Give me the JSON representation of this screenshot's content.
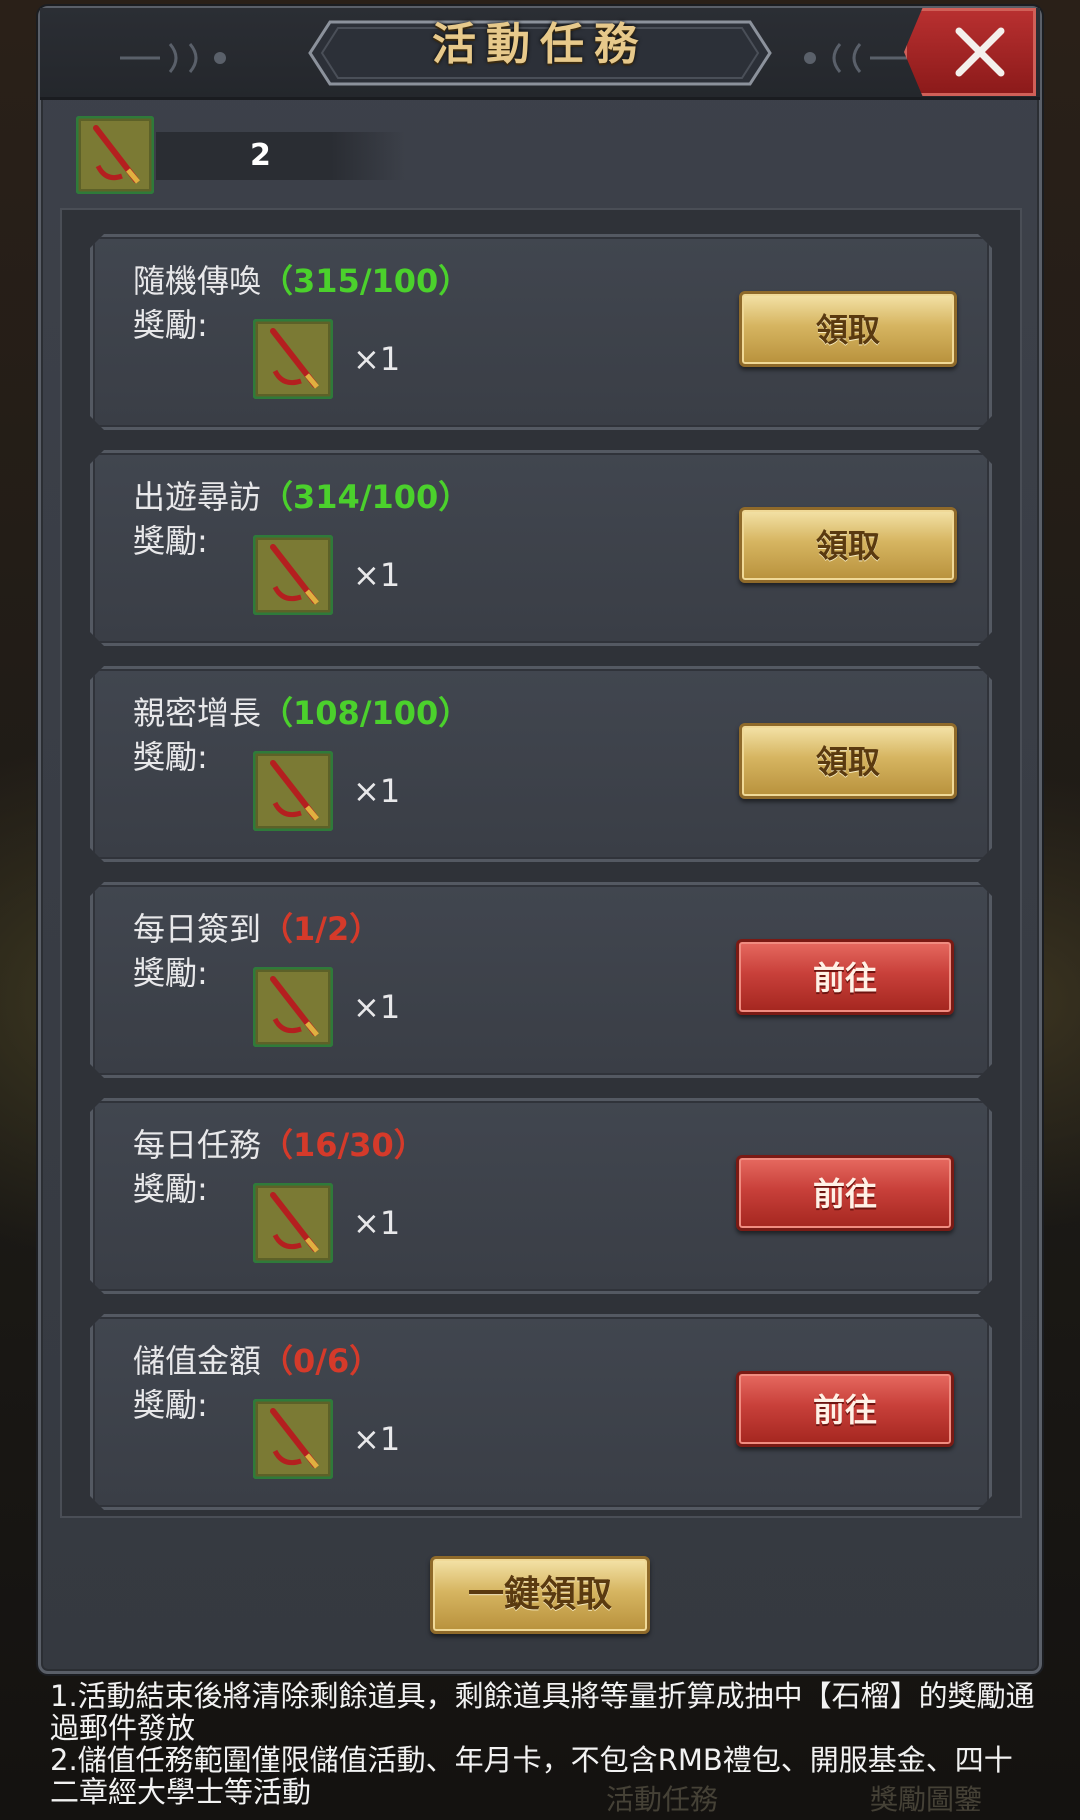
{
  "title": "活動任務",
  "currency": {
    "value": "2",
    "icon": "brush-pen-item-icon"
  },
  "tasks": [
    {
      "name": "隨機傳喚",
      "progress": "（315/100）",
      "done": true,
      "reward_label": "獎勵:",
      "reward_qty": "×1",
      "button": "領取"
    },
    {
      "name": "出遊尋訪",
      "progress": "（314/100）",
      "done": true,
      "reward_label": "獎勵:",
      "reward_qty": "×1",
      "button": "領取"
    },
    {
      "name": "親密增長",
      "progress": "（108/100）",
      "done": true,
      "reward_label": "獎勵:",
      "reward_qty": "×1",
      "button": "領取"
    },
    {
      "name": "每日簽到",
      "progress": "（1/2）",
      "done": false,
      "reward_label": "獎勵:",
      "reward_qty": "×1",
      "button": "前往"
    },
    {
      "name": "每日任務",
      "progress": "（16/30）",
      "done": false,
      "reward_label": "獎勵:",
      "reward_qty": "×1",
      "button": "前往"
    },
    {
      "name": "儲值金額",
      "progress": "（0/6）",
      "done": false,
      "reward_label": "獎勵:",
      "reward_qty": "×1",
      "button": "前往"
    }
  ],
  "claim_all": "一鍵領取",
  "notes": [
    "1.活動結束後將清除剩餘道具，剩餘道具將等量折算成抽中【石榴】的獎勵通過郵件發放",
    "2.儲值任務範圍僅限儲值活動、年月卡，不包含RMB禮包、開服基金、四十二章經大學士等活動"
  ],
  "bottom_tabs": [
    "活動任務",
    "獎勵圖鑒"
  ],
  "colors": {
    "progress_ok": "#4bd12c",
    "progress_no": "#d53a2a",
    "title": "#e7c98b"
  }
}
